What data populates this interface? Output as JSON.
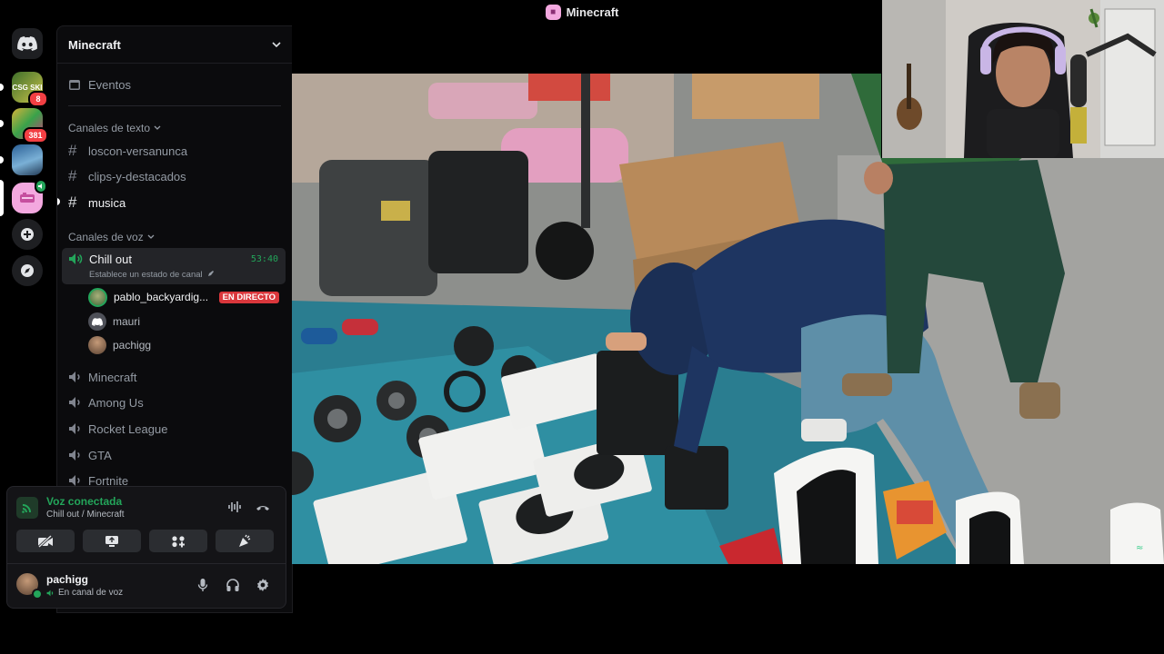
{
  "window": {
    "title": "Minecraft"
  },
  "rail": {
    "servers": [
      {
        "icon": "csgo-skins-server-icon",
        "label": "CSG SKI",
        "badge": "8"
      },
      {
        "icon": "colorful-server-icon",
        "label": "",
        "badge": "381"
      },
      {
        "icon": "game-art-server-icon",
        "label": "",
        "badge": ""
      },
      {
        "icon": "minecraft-pink-server-icon",
        "label": "",
        "badge": ""
      }
    ]
  },
  "sidebar": {
    "server_name": "Minecraft",
    "events_label": "Eventos",
    "text_category": "Canales de texto",
    "text_channels": [
      "loscon-versanunca",
      "clips-y-destacados",
      "musica"
    ],
    "voice_category": "Canales de voz",
    "active_voice": {
      "name": "Chill out",
      "timer": "53:40",
      "status_hint": "Establece un estado de canal"
    },
    "voice_users": [
      {
        "name": "pablo_backyardig...",
        "live": "EN DIRECTO",
        "color": "#3f6b3a"
      },
      {
        "name": "mauri",
        "live": "",
        "color": "#5865f2"
      },
      {
        "name": "pachigg",
        "live": "",
        "color": "#8a6a4b"
      }
    ],
    "voice_channels": [
      "Minecraft",
      "Among Us",
      "Rocket League",
      "GTA",
      "Fortnite"
    ]
  },
  "voice_panel": {
    "status": "Voz conectada",
    "location": "Chill out / Minecraft",
    "user": {
      "name": "pachigg",
      "status": "En canal de voz"
    }
  },
  "colors": {
    "accent_green": "#23a55a",
    "live_red": "#da373c",
    "badge_red": "#f23f43"
  }
}
